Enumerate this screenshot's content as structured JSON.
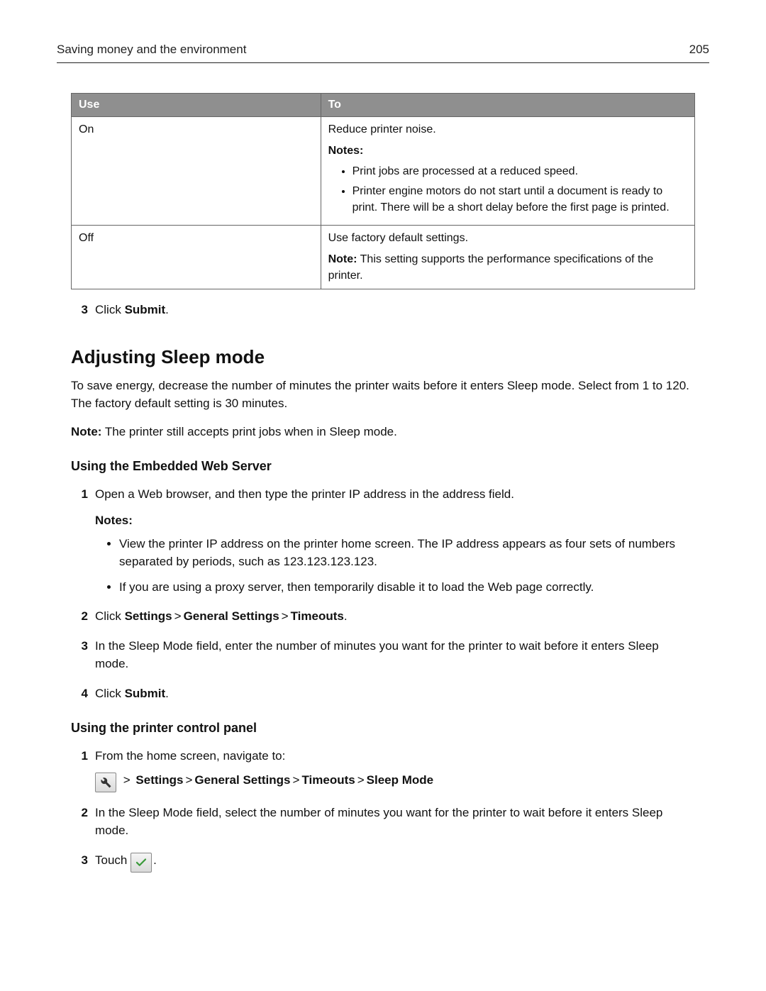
{
  "header": {
    "title": "Saving money and the environment",
    "page": "205"
  },
  "table": {
    "head": {
      "use": "Use",
      "to": "To"
    },
    "rows": [
      {
        "use": "On",
        "to_line": "Reduce printer noise.",
        "notes_label": "Notes:",
        "bullets": [
          "Print jobs are processed at a reduced speed.",
          "Printer engine motors do not start until a document is ready to print. There will be a short delay before the first page is printed."
        ]
      },
      {
        "use": "Off",
        "to_line": "Use factory default settings.",
        "note_label": "Note:",
        "note_text": " This setting supports the performance specifications of the printer."
      }
    ]
  },
  "pre_step3": {
    "num": "3",
    "prefix": "Click ",
    "bold": "Submit",
    "suffix": "."
  },
  "section": {
    "heading": "Adjusting Sleep mode",
    "intro": "To save energy, decrease the number of minutes the printer waits before it enters Sleep mode. Select from 1 to 120. The factory default setting is 30 minutes.",
    "note_label": "Note:",
    "note_text": " The printer still accepts print jobs when in Sleep mode."
  },
  "ews": {
    "heading": "Using the Embedded Web Server",
    "step1": {
      "num": "1",
      "text": "Open a Web browser, and then type the printer IP address in the address field."
    },
    "notes_title": "Notes:",
    "notes": [
      "View the printer IP address on the printer home screen. The IP address appears as four sets of numbers separated by periods, such as 123.123.123.123.",
      "If you are using a proxy server, then temporarily disable it to load the Web page correctly."
    ],
    "step2": {
      "num": "2",
      "prefix": "Click ",
      "path": [
        "Settings",
        "General Settings",
        "Timeouts"
      ],
      "suffix": "."
    },
    "step3": {
      "num": "3",
      "text": "In the Sleep Mode field, enter the number of minutes you want for the printer to wait before it enters Sleep mode."
    },
    "step4": {
      "num": "4",
      "prefix": "Click ",
      "bold": "Submit",
      "suffix": "."
    }
  },
  "panel": {
    "heading": "Using the printer control panel",
    "step1": {
      "num": "1",
      "text": "From the home screen, navigate to:"
    },
    "nav": {
      "sep": " > ",
      "path": [
        "Settings",
        "General Settings",
        "Timeouts",
        "Sleep Mode"
      ]
    },
    "step2": {
      "num": "2",
      "text": "In the Sleep Mode field, select the number of minutes you want for the printer to wait before it enters Sleep mode."
    },
    "step3": {
      "num": "3",
      "prefix": "Touch ",
      "suffix": "."
    }
  }
}
